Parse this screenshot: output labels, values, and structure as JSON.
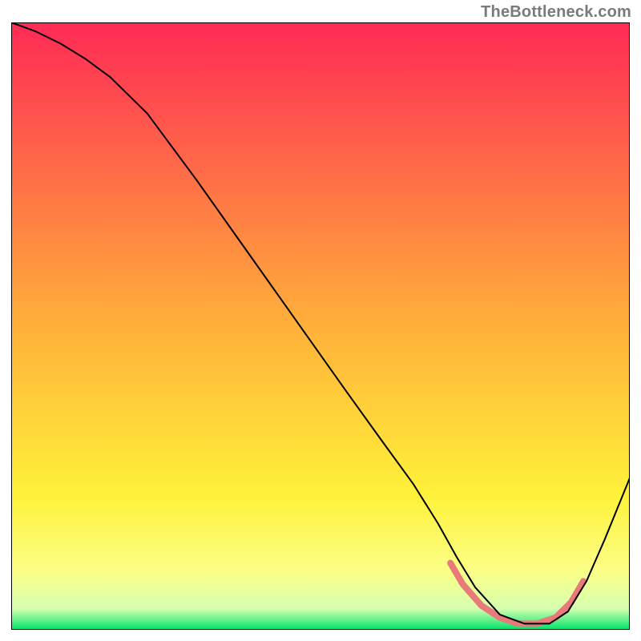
{
  "attribution": "TheBottleneck.com",
  "chart_data": {
    "type": "line",
    "title": "",
    "xlabel": "",
    "ylabel": "",
    "xlim": [
      0,
      100
    ],
    "ylim": [
      0,
      100
    ],
    "grid": false,
    "legend": false,
    "background_gradient_stops": [
      {
        "offset": 0.0,
        "color": "#ff2a55"
      },
      {
        "offset": 0.5,
        "color": "#ffb03a"
      },
      {
        "offset": 0.78,
        "color": "#fff23a"
      },
      {
        "offset": 0.905,
        "color": "#fbff88"
      },
      {
        "offset": 0.965,
        "color": "#d6ffb0"
      },
      {
        "offset": 1.0,
        "color": "#00e46a"
      }
    ],
    "series": [
      {
        "name": "bottleneck-curve",
        "color": "#000000",
        "stroke_width": 2,
        "x": [
          0,
          4,
          8,
          12,
          16,
          22,
          30,
          38,
          46,
          54,
          60,
          65,
          69,
          72,
          75,
          79,
          83,
          87,
          90,
          93,
          96,
          100
        ],
        "y": [
          100,
          98.5,
          96.5,
          94,
          91,
          85,
          74,
          62.5,
          51,
          39.5,
          31,
          24,
          17.5,
          12,
          7,
          2.5,
          1,
          1,
          3,
          8,
          15,
          25
        ]
      },
      {
        "name": "optimal-range-highlight",
        "color": "#e87a7a",
        "stroke_width": 8,
        "stroke_linecap": "round",
        "x": [
          71,
          73,
          76,
          79,
          82,
          85,
          88,
          90.5,
          92.5
        ],
        "y": [
          11,
          7.5,
          4,
          2,
          1,
          1,
          2,
          4.5,
          8
        ]
      }
    ]
  }
}
